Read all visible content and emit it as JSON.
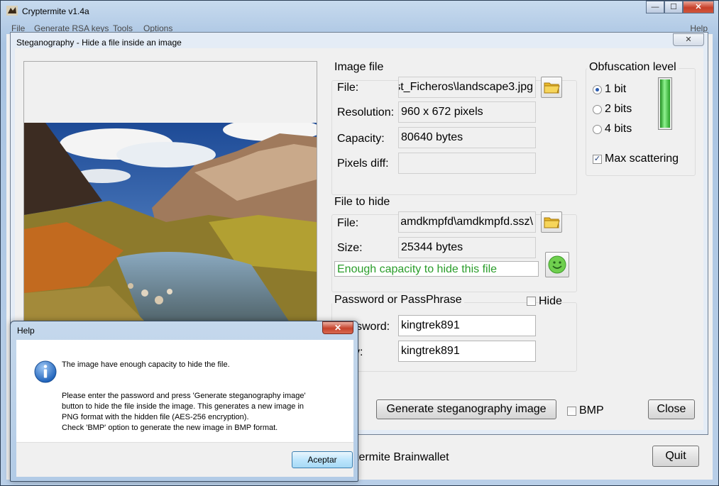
{
  "main_window": {
    "title": "Cryptermite v1.4a",
    "caption_buttons": {
      "minimize": "—",
      "maximize": "☐",
      "close": "✕"
    },
    "menu": [
      "File",
      "Generate RSA keys",
      "Tools",
      "Options"
    ],
    "help_menu": "Help",
    "brainwallet_label": "termite Brainwallet",
    "quit_button": "Quit"
  },
  "stego_dialog": {
    "title": "Steganography - Hide a file inside an image",
    "close_glyph": "✕",
    "image_file": {
      "group_title": "Image file",
      "file_label": "File:",
      "file_value": "st_Ficheros\\landscape3.jpg",
      "resolution_label": "Resolution:",
      "resolution_value": "960 x 672 pixels",
      "capacity_label": "Capacity:",
      "capacity_value": "80640 bytes",
      "pixels_diff_label": "Pixels diff:",
      "pixels_diff_value": ""
    },
    "obfuscation": {
      "group_title": "Obfuscation level",
      "options": [
        {
          "label": "1 bit",
          "selected": true
        },
        {
          "label": "2 bits",
          "selected": false
        },
        {
          "label": "4 bits",
          "selected": false
        }
      ],
      "level_fraction": 1.0,
      "max_scattering_label": "Max scattering",
      "max_scattering_checked": true
    },
    "file_to_hide": {
      "group_title": "File to hide",
      "file_label": "File:",
      "file_value": "\\amdkmpfd\\amdkmpfd.ssz",
      "size_label": "Size:",
      "size_value": "25344 bytes",
      "status_text": "Enough capacity to hide this file",
      "status_color": "#2a9d2a"
    },
    "password": {
      "group_title": "Password or PassPhrase",
      "hide_label": "Hide",
      "hide_checked": false,
      "password_label": "ssword:",
      "password_value": "kingtrek891",
      "verify_label": "y:",
      "verify_value": "kingtrek891"
    },
    "generate_button": "Generate steganography image",
    "bmp_label": "BMP",
    "bmp_checked": false,
    "close_button": "Close"
  },
  "help_dialog": {
    "title": "Help",
    "close_glyph": "✕",
    "icon": "info-icon",
    "main_text": "The image have enough capacity to hide the file.",
    "detail_lines": [
      "Please enter the password and press 'Generate steganography image'",
      "button to hide the file inside the image. This generates a new image in",
      "PNG format with the hidden file (AES-256 encryption).",
      "Check 'BMP' option to generate the new image in BMP format."
    ],
    "ok_button": "Aceptar"
  }
}
